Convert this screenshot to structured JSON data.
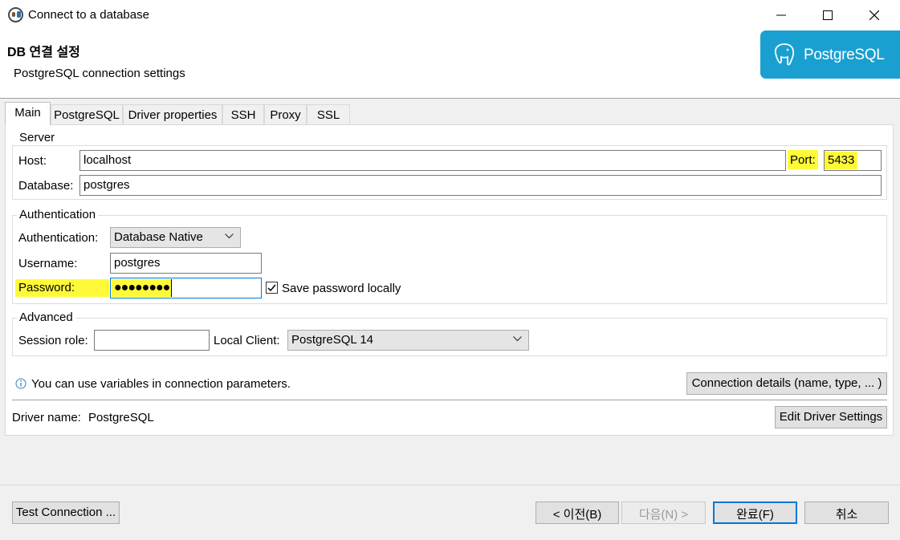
{
  "window": {
    "title": "Connect to a database"
  },
  "header": {
    "title": "DB 연결 설정",
    "subtitle": "PostgreSQL connection settings",
    "brand_text": "PostgreSQL"
  },
  "tabs": [
    {
      "label": "Main",
      "active": true
    },
    {
      "label": "PostgreSQL",
      "active": false
    },
    {
      "label": "Driver properties",
      "active": false
    },
    {
      "label": "SSH",
      "active": false
    },
    {
      "label": "Proxy",
      "active": false
    },
    {
      "label": "SSL",
      "active": false
    }
  ],
  "server": {
    "group_label": "Server",
    "host_label": "Host:",
    "host_value": "localhost",
    "port_label": "Port:",
    "port_value": "5433",
    "database_label": "Database:",
    "database_value": "postgres"
  },
  "auth": {
    "group_label": "Authentication",
    "auth_label": "Authentication:",
    "auth_value": "Database Native",
    "username_label": "Username:",
    "username_value": "postgres",
    "password_label": "Password:",
    "password_value": "●●●●●●●●",
    "save_password_label": "Save password locally",
    "save_password_checked": true
  },
  "advanced": {
    "group_label": "Advanced",
    "session_role_label": "Session role:",
    "session_role_value": "",
    "local_client_label": "Local Client:",
    "local_client_value": "PostgreSQL 14"
  },
  "info": {
    "text": "You can use variables in connection parameters.",
    "connection_details_button": "Connection details (name, type, ... )"
  },
  "driver": {
    "label": "Driver name:",
    "value": "PostgreSQL",
    "edit_button": "Edit Driver Settings"
  },
  "footer": {
    "test_connection": "Test Connection ...",
    "back": "< 이전(B)",
    "next": "다음(N) >",
    "finish": "완료(F)",
    "cancel": "취소"
  },
  "colors": {
    "highlight": "#fffa39",
    "brand": "#1aa0d0",
    "focus": "#0078d7"
  }
}
